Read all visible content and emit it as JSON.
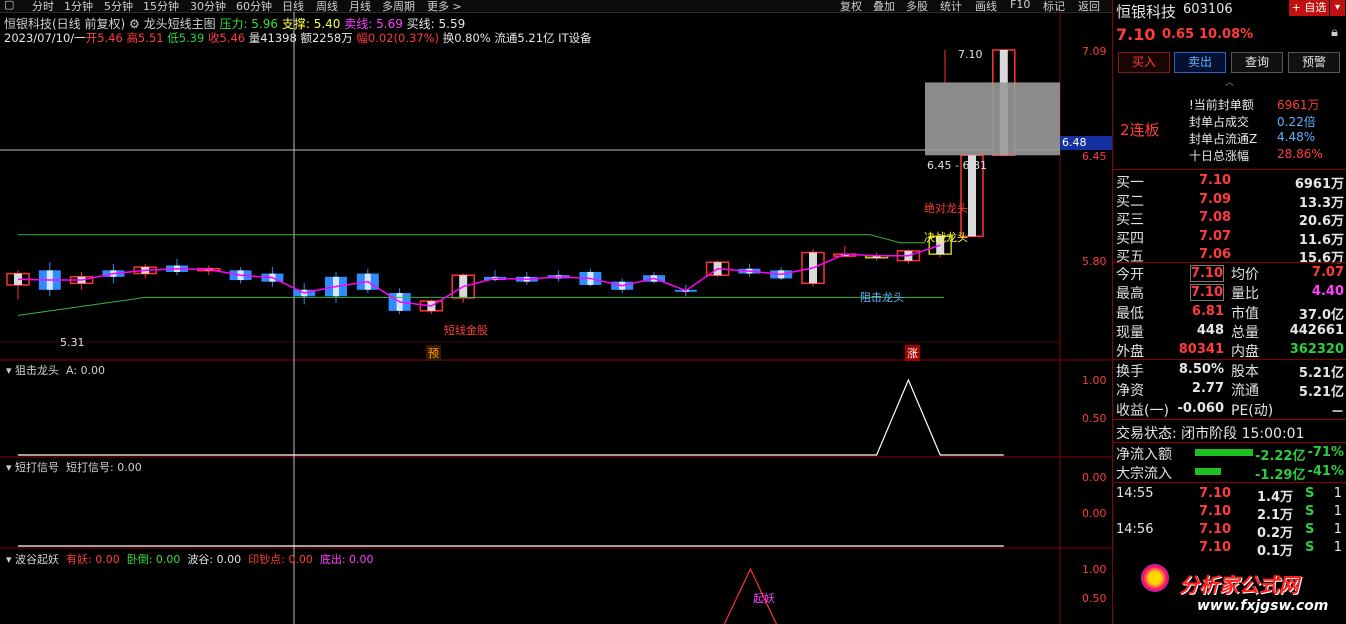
{
  "toolbar": {
    "tabs": [
      "分时",
      "1分钟",
      "5分钟",
      "15分钟",
      "30分钟",
      "60分钟",
      "日线",
      "周线",
      "月线",
      "多周期",
      "更多 >"
    ],
    "right_tabs": [
      "复权",
      "叠加",
      "多股",
      "统计",
      "画线",
      "F10",
      "标记",
      "返回"
    ]
  },
  "header": {
    "line1": {
      "stock_label": "恒银科技(日线 前复权)",
      "indicator": "龙头短线主图",
      "pressure": "压力: 5.96",
      "support": "支撑: 5.40",
      "sell": "卖线: 5.69",
      "buy": "买线: 5.59"
    },
    "line2": {
      "date": "2023/07/10/一",
      "open": "开5.46",
      "high": "高5.51",
      "low": "低5.39",
      "close": "收5.46",
      "volume": "量41398",
      "amount": "额2258万",
      "amplitude": "幅0.02(0.37%)",
      "turnover": "换0.80%",
      "float": "流通5.21亿",
      "sector": "IT设备"
    }
  },
  "main_panel": {
    "price_axis": [
      "7.09",
      "6.45",
      "5.80"
    ],
    "current_price_tag": "6.48",
    "annotations": {
      "high_label": "7.10",
      "low_label": "5.31",
      "gap_range": "6.45 - 6.81",
      "absolute_leader": "绝对龙头",
      "decisive_leader": "决战龙头",
      "block_leader": "阻击龙头",
      "short_lock": "短线金股",
      "marker_pre": "预",
      "marker_limit": "涨"
    },
    "colors": {
      "up": "#ff3232",
      "down": "#2f8cff",
      "yellow": "#c8c800",
      "line_green": "#3cb43c",
      "line_magenta": "#ff00ff"
    }
  },
  "chart_data": [
    {
      "type": "candlestick",
      "title": "龙头短线主图",
      "series": [
        {
          "name": "K线",
          "values": [
            [
              5.65,
              5.74,
              5.56,
              5.72
            ],
            [
              5.74,
              5.79,
              5.58,
              5.62
            ],
            [
              5.66,
              5.73,
              5.62,
              5.7
            ],
            [
              5.74,
              5.78,
              5.66,
              5.7
            ],
            [
              5.72,
              5.78,
              5.69,
              5.76
            ],
            [
              5.77,
              5.81,
              5.71,
              5.73
            ],
            [
              5.74,
              5.77,
              5.71,
              5.75
            ],
            [
              5.74,
              5.76,
              5.66,
              5.68
            ],
            [
              5.72,
              5.76,
              5.64,
              5.67
            ],
            [
              5.62,
              5.66,
              5.53,
              5.58
            ],
            [
              5.7,
              5.73,
              5.54,
              5.58
            ],
            [
              5.72,
              5.75,
              5.6,
              5.62
            ],
            [
              5.6,
              5.63,
              5.47,
              5.49
            ],
            [
              5.49,
              5.56,
              5.47,
              5.55
            ],
            [
              5.57,
              5.72,
              5.54,
              5.71
            ],
            [
              5.7,
              5.74,
              5.67,
              5.68
            ],
            [
              5.7,
              5.73,
              5.65,
              5.67
            ],
            [
              5.71,
              5.74,
              5.67,
              5.69
            ],
            [
              5.73,
              5.75,
              5.64,
              5.65
            ],
            [
              5.67,
              5.69,
              5.6,
              5.62
            ],
            [
              5.71,
              5.73,
              5.66,
              5.67
            ],
            [
              5.62,
              5.65,
              5.58,
              5.61
            ],
            [
              5.71,
              5.8,
              5.7,
              5.79
            ],
            [
              5.75,
              5.78,
              5.7,
              5.72
            ],
            [
              5.74,
              5.76,
              5.68,
              5.69
            ],
            [
              5.66,
              5.87,
              5.64,
              5.85
            ],
            [
              5.84,
              5.89,
              5.82,
              5.84
            ],
            [
              5.83,
              5.85,
              5.8,
              5.83
            ],
            [
              5.8,
              5.87,
              5.78,
              5.86
            ],
            [
              5.84,
              5.96,
              5.82,
              5.95
            ],
            [
              5.95,
              6.45,
              5.95,
              6.45
            ],
            [
              6.45,
              7.1,
              6.45,
              7.1
            ]
          ]
        },
        {
          "name": "压力",
          "values": [
            5.96
          ]
        },
        {
          "name": "支撑",
          "values": [
            5.4
          ]
        }
      ],
      "ylim": [
        5.31,
        7.1
      ]
    },
    {
      "type": "line",
      "title": "狙击龙头",
      "series": [
        {
          "name": "A",
          "values": [
            0,
            0,
            0,
            0,
            0,
            0,
            0,
            0,
            0,
            0,
            0,
            0,
            0,
            0,
            0,
            0,
            0,
            0,
            0,
            0,
            0,
            0,
            0,
            0,
            0,
            0,
            0,
            0,
            1,
            0,
            0,
            0
          ]
        }
      ],
      "ylim": [
        0,
        1
      ],
      "y_ticks": [
        "1.00",
        "0.50"
      ],
      "value_label": "A: 0.00"
    },
    {
      "type": "line",
      "title": "短打信号",
      "series": [
        {
          "name": "短打信号",
          "values": [
            0,
            0,
            0,
            0,
            0,
            0,
            0,
            0,
            0,
            0,
            0,
            0,
            0,
            0,
            0,
            0,
            0,
            0,
            0,
            0,
            0,
            0,
            0,
            0,
            0,
            0,
            0,
            0,
            0,
            0,
            0,
            0
          ]
        }
      ],
      "y_ticks": [
        "0.00",
        "0.00"
      ],
      "value_label": "短打信号: 0.00"
    },
    {
      "type": "line",
      "title": "波谷起妖",
      "series": [
        {
          "name": "有妖",
          "values": [
            0
          ]
        },
        {
          "name": "卧倒",
          "values": [
            0
          ]
        },
        {
          "name": "波谷",
          "values": [
            0
          ]
        },
        {
          "name": "印钞点",
          "values": [
            0
          ]
        },
        {
          "name": "底出",
          "values": [
            0
          ]
        }
      ],
      "y_ticks": [
        "1.00",
        "0.50"
      ],
      "value_labels": [
        "有妖: 0.00",
        "卧倒: 0.00",
        "波谷: 0.00",
        "印钞点: 0.00",
        "底出: 0.00"
      ],
      "annotation": "起妖"
    }
  ],
  "sidebar": {
    "name": "恒银科技",
    "code": "603106",
    "add_button": "+ 自选",
    "price": "7.10",
    "change": "0.65",
    "change_pct": "10.08%",
    "buttons": [
      "买入",
      "卖出",
      "查询",
      "预警"
    ],
    "streak": "2连板",
    "seal": [
      {
        "k": "!当前封单额",
        "v": "6961万"
      },
      {
        "k": "封单占成交",
        "v": "0.22倍"
      },
      {
        "k": "封单占流通Z",
        "v": "4.48%"
      },
      {
        "k": "十日总涨幅",
        "v": "28.86%"
      }
    ],
    "bids": [
      {
        "k": "买一",
        "p": "7.10",
        "q": "6961万"
      },
      {
        "k": "买二",
        "p": "7.09",
        "q": "13.3万"
      },
      {
        "k": "买三",
        "p": "7.08",
        "q": "20.6万"
      },
      {
        "k": "买四",
        "p": "7.07",
        "q": "11.6万"
      },
      {
        "k": "买五",
        "p": "7.06",
        "q": "15.6万"
      }
    ],
    "stats": [
      {
        "k1": "今开",
        "v1": "7.10",
        "k2": "均价",
        "v2": "7.07"
      },
      {
        "k1": "最高",
        "v1": "7.10",
        "k2": "量比",
        "v2": "4.40"
      },
      {
        "k1": "最低",
        "v1": "6.81",
        "k2": "市值",
        "v2": "37.0亿"
      },
      {
        "k1": "现量",
        "v1": "448",
        "k2": "总量",
        "v2": "442661"
      },
      {
        "k1": "外盘",
        "v1": "80341",
        "k2": "内盘",
        "v2": "362320"
      }
    ],
    "stats2": [
      {
        "k1": "换手",
        "v1": "8.50%",
        "k2": "股本",
        "v2": "5.21亿"
      },
      {
        "k1": "净资",
        "v1": "2.77",
        "k2": "流通",
        "v2": "5.21亿"
      },
      {
        "k1": "收益(一)",
        "v1": "-0.060",
        "k2": "PE(动)",
        "v2": "－"
      }
    ],
    "trade_status": "交易状态: 闭市阶段 15:00:01",
    "flows": [
      {
        "k": "净流入额",
        "v": "-2.22亿",
        "p": "-71%"
      },
      {
        "k": "大宗流入",
        "v": "-1.29亿",
        "p": "-41%"
      }
    ],
    "ticks": [
      {
        "t": "14:55",
        "p": "7.10",
        "q": "1.4万",
        "s": "S",
        "n": "1"
      },
      {
        "t": "",
        "p": "7.10",
        "q": "2.1万",
        "s": "S",
        "n": "1"
      },
      {
        "t": "14:56",
        "p": "7.10",
        "q": "0.2万",
        "s": "S",
        "n": "1"
      },
      {
        "t": "",
        "p": "7.10",
        "q": "0.1万",
        "s": "S",
        "n": "1"
      }
    ],
    "watermark": "分析家公式网",
    "watermark_url": "www.fxjgsw.com"
  }
}
